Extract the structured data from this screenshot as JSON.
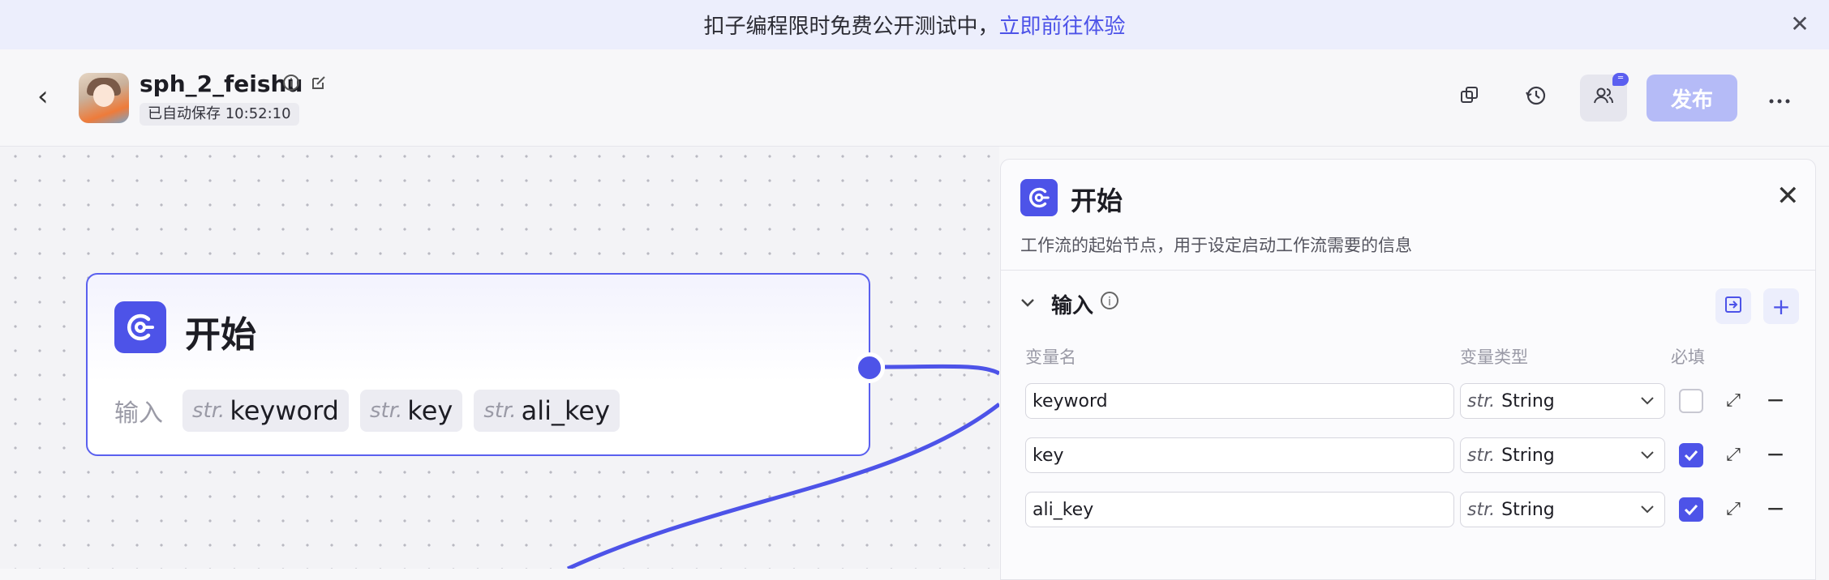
{
  "banner": {
    "text": "扣子编程限时免费公开测试中，",
    "link": "立即前往体验",
    "close_icon": "close-icon"
  },
  "header": {
    "title": "sph_2_feishu",
    "saved_status": "已自动保存 10:52:10",
    "publish_label": "发布",
    "icons": [
      "back-icon",
      "info-icon",
      "edit-icon",
      "copy-icon",
      "history-icon",
      "collaborators-icon",
      "more-icon"
    ]
  },
  "node": {
    "title": "开始",
    "inputs_label": "输入",
    "inputs": [
      {
        "type": "str.",
        "name": "keyword"
      },
      {
        "type": "str.",
        "name": "key"
      },
      {
        "type": "str.",
        "name": "ali_key"
      }
    ]
  },
  "panel": {
    "title": "开始",
    "description": "工作流的起始节点，用于设定启动工作流需要的信息",
    "section_title": "输入",
    "columns": {
      "name": "变量名",
      "type": "变量类型",
      "required": "必填"
    },
    "rows": [
      {
        "name": "keyword",
        "type_prefix": "str.",
        "type": "String",
        "required": false
      },
      {
        "name": "key",
        "type_prefix": "str.",
        "type": "String",
        "required": true
      },
      {
        "name": "ali_key",
        "type_prefix": "str.",
        "type": "String",
        "required": true
      }
    ]
  },
  "colors": {
    "accent": "#4d53e8",
    "publish_disabled": "#b5bbf7",
    "banner_bg": "#eceefc"
  }
}
